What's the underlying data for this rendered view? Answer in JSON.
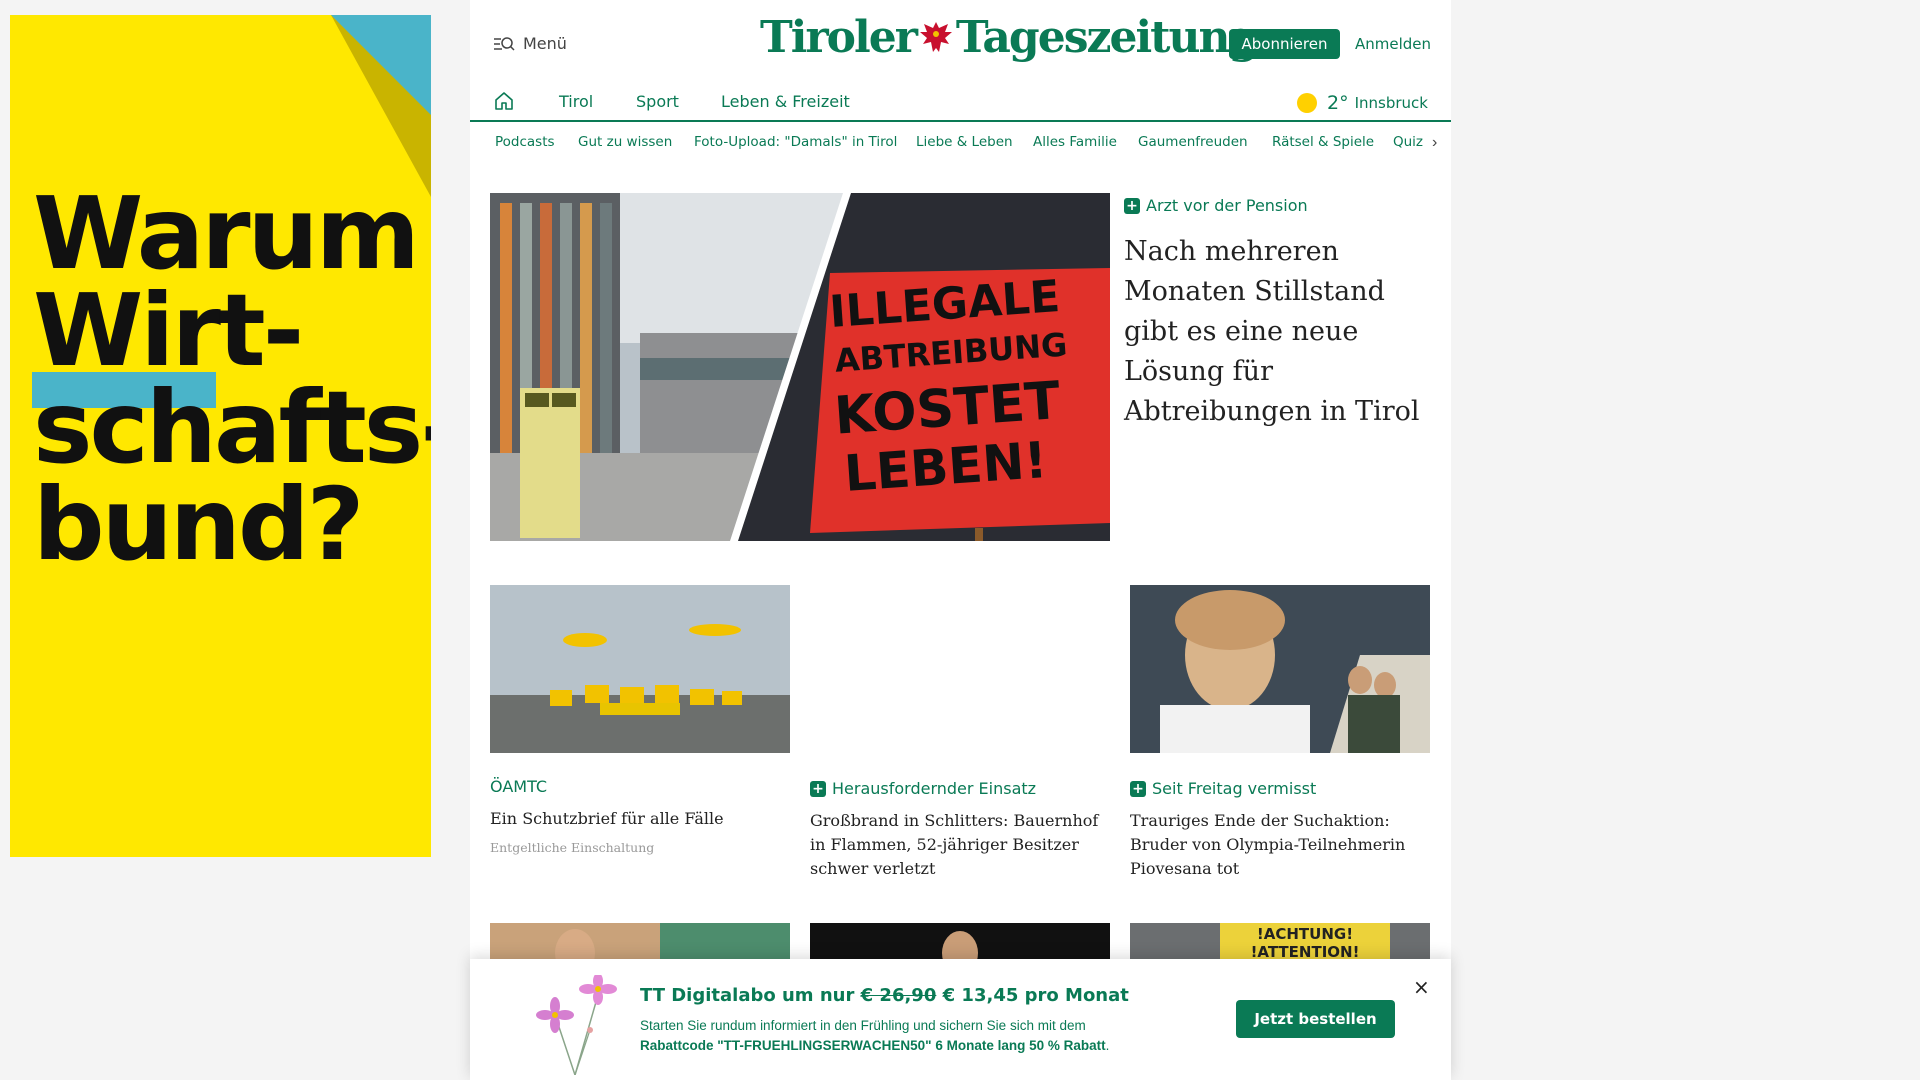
{
  "ad": {
    "lines": [
      "Warum",
      "Wirt-",
      "schafts-",
      "bund?"
    ],
    "colors": {
      "background": "#ffe800",
      "accent": "#4ab4c9",
      "fold": "#c9b400"
    }
  },
  "header": {
    "menu_label": "Menü",
    "logo_left": "Tiroler",
    "logo_right": "Tageszeitung",
    "subscribe_label": "Abonnieren",
    "login_label": "Anmelden",
    "brand_color": "#0a7a55"
  },
  "mainnav": {
    "items": [
      {
        "label": "Tirol"
      },
      {
        "label": "Sport"
      },
      {
        "label": "Leben & Freizeit"
      }
    ],
    "weather": {
      "temp": "2°",
      "city": "Innsbruck",
      "icon": "sun-icon"
    }
  },
  "subnav": {
    "items": [
      {
        "label": "Podcasts"
      },
      {
        "label": "Gut zu wissen"
      },
      {
        "label": "Foto-Upload: \"Damals\" in Tirol"
      },
      {
        "label": "Liebe & Leben"
      },
      {
        "label": "Alles Familie"
      },
      {
        "label": "Gaumenfreuden"
      },
      {
        "label": "Rätsel & Spiele"
      },
      {
        "label": "Quiz"
      }
    ]
  },
  "lead": {
    "kicker": "Arzt vor der Pension",
    "title": "Nach mehreren Monaten Stillstand gibt es eine neue Lösung für Abtreibungen in Tirol",
    "sign_text": [
      "ILLEGALE",
      "ABTREIBUNG",
      "KOSTET",
      "LEBEN!"
    ]
  },
  "cards": [
    {
      "kicker": "ÖAMTC",
      "title": "Ein Schutzbrief für alle Fälle",
      "sponsor": "Entgeltliche Einschaltung"
    },
    {
      "kicker": "Herausfordernder Einsatz",
      "title": "Großbrand in Schlitters: Bauernhof in Flammen, 52-jähriger Besitzer schwer verletzt"
    },
    {
      "kicker": "Seit Freitag vermisst",
      "title": "Trauriges Ende der Suchaktion: Bruder von Olympia-Teilnehmerin Piovesana tot"
    }
  ],
  "teaser_sign": [
    "!ACHTUNG!",
    "!ATTENTION!"
  ],
  "promo": {
    "title_prefix": "TT Digitalabo um nur",
    "old_price": "€ 26,90",
    "new_price": "€ 13,45 pro Monat",
    "text": "Starten Sie rundum informiert in den Frühling und sichern Sie sich mit dem",
    "text_bold": "Rabattcode \"TT-FRUEHLINGSERWACHEN50\" 6 Monate lang 50 % Rabatt",
    "text_end": ".",
    "button_label": "Jetzt bestellen",
    "close_label": "×"
  }
}
